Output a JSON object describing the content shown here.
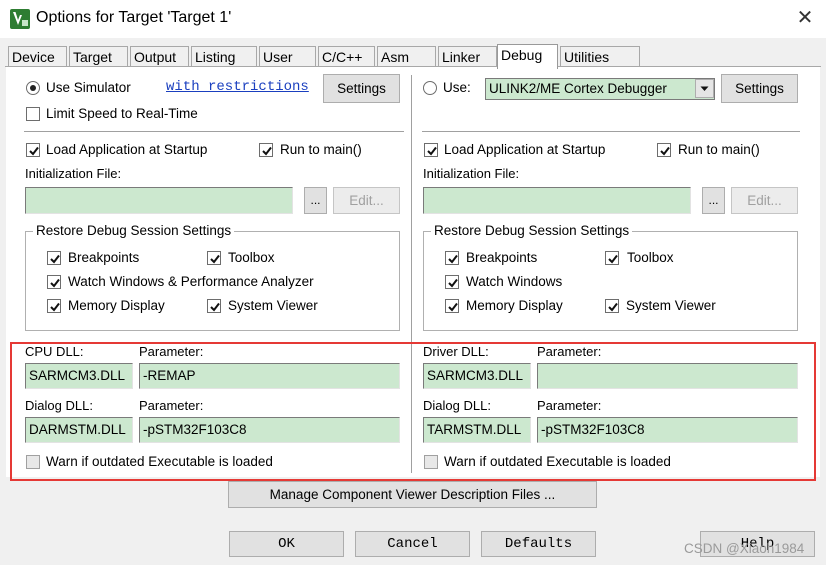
{
  "window": {
    "title": "Options for Target 'Target 1'",
    "close_label": "✕"
  },
  "tabs": [
    {
      "label": "Device",
      "active": false
    },
    {
      "label": "Target",
      "active": false
    },
    {
      "label": "Output",
      "active": false
    },
    {
      "label": "Listing",
      "active": false
    },
    {
      "label": "User",
      "active": false
    },
    {
      "label": "C/C++",
      "active": false
    },
    {
      "label": "Asm",
      "active": false
    },
    {
      "label": "Linker",
      "active": false
    },
    {
      "label": "Debug",
      "active": true
    },
    {
      "label": "Utilities",
      "active": false
    }
  ],
  "left": {
    "use_simulator_label": "Use Simulator",
    "use_simulator_selected": true,
    "restrictions_link": "with restrictions",
    "settings_label": "Settings",
    "limit_speed_label": "Limit Speed to Real-Time",
    "limit_speed_checked": false,
    "load_app_label": "Load Application at Startup",
    "load_app_checked": true,
    "run_main_label": "Run to main()",
    "run_main_checked": true,
    "init_file_label": "Initialization File:",
    "init_file_value": "",
    "browse_label": "...",
    "edit_label": "Edit...",
    "restore_group_title": "Restore Debug Session Settings",
    "breakpoints_label": "Breakpoints",
    "toolbox_label": "Toolbox",
    "watch_label": "Watch Windows & Performance Analyzer",
    "memory_label": "Memory Display",
    "sysviewer_label": "System Viewer",
    "cpu_dll_label": "CPU DLL:",
    "cpu_dll_value": "SARMCM3.DLL",
    "cpu_param_label": "Parameter:",
    "cpu_param_value": "-REMAP",
    "dialog_dll_label": "Dialog DLL:",
    "dialog_dll_value": "DARMSTM.DLL",
    "dialog_param_label": "Parameter:",
    "dialog_param_value": "-pSTM32F103C8",
    "warn_label": "Warn if outdated Executable is loaded",
    "warn_checked": false
  },
  "right": {
    "use_label": "Use:",
    "use_selected": false,
    "debugger_value": "ULINK2/ME Cortex Debugger",
    "settings_label": "Settings",
    "load_app_label": "Load Application at Startup",
    "load_app_checked": true,
    "run_main_label": "Run to main()",
    "run_main_checked": true,
    "init_file_label": "Initialization File:",
    "init_file_value": "",
    "browse_label": "...",
    "edit_label": "Edit...",
    "restore_group_title": "Restore Debug Session Settings",
    "breakpoints_label": "Breakpoints",
    "toolbox_label": "Toolbox",
    "watch_label": "Watch Windows",
    "memory_label": "Memory Display",
    "sysviewer_label": "System Viewer",
    "driver_dll_label": "Driver DLL:",
    "driver_dll_value": "SARMCM3.DLL",
    "driver_param_label": "Parameter:",
    "driver_param_value": "",
    "dialog_dll_label": "Dialog DLL:",
    "dialog_dll_value": "TARMSTM.DLL",
    "dialog_param_label": "Parameter:",
    "dialog_param_value": "-pSTM32F103C8",
    "warn_label": "Warn if outdated Executable is loaded",
    "warn_checked": false
  },
  "manage_button_label": "Manage Component Viewer Description Files ...",
  "footer": {
    "ok_label": "OK",
    "cancel_label": "Cancel",
    "defaults_label": "Defaults",
    "help_label": "Help"
  },
  "watermark": "CSDN @Xiaoh1984",
  "colors": {
    "field_green": "#cce8cf",
    "highlight_red": "#e53935",
    "link_blue": "#1a3fbf"
  }
}
